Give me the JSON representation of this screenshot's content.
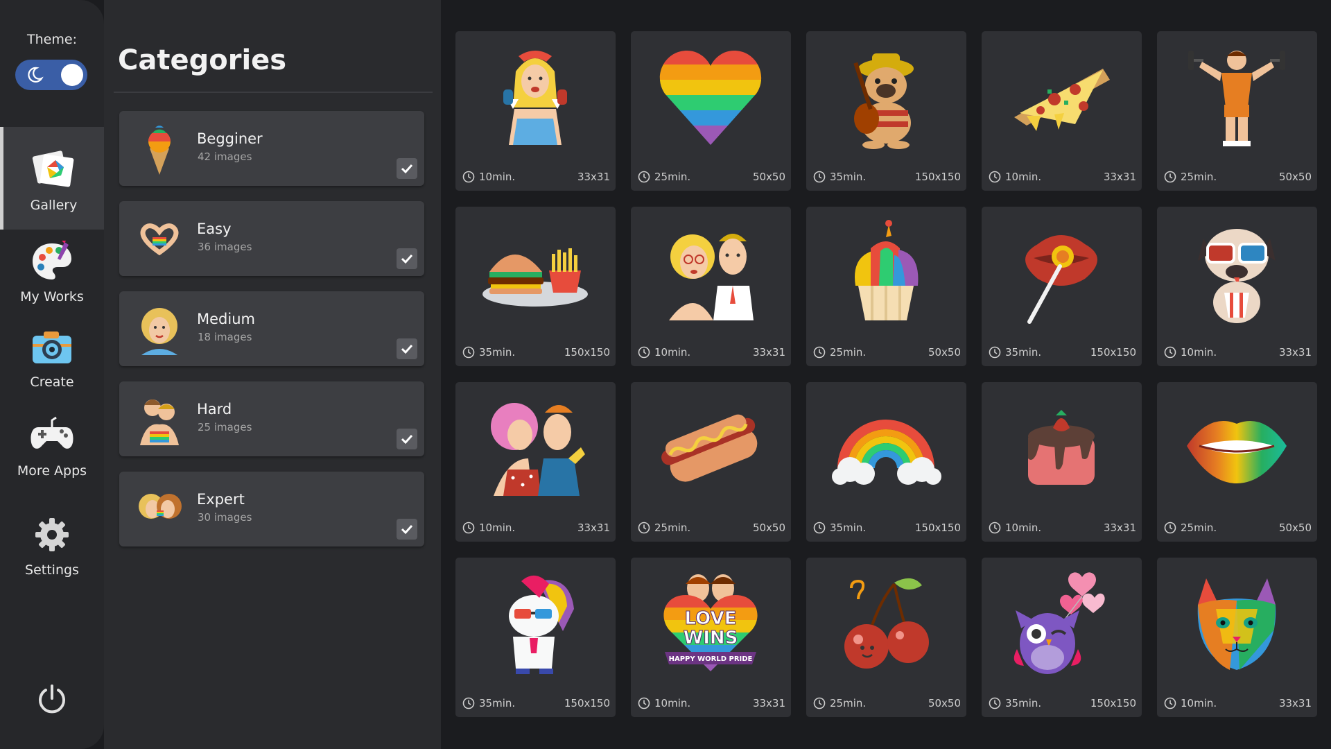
{
  "theme": {
    "label": "Theme:",
    "mode": "dark"
  },
  "nav": [
    {
      "label": "Gallery",
      "icon": "gallery-icon",
      "active": true
    },
    {
      "label": "My Works",
      "icon": "palette-icon",
      "active": false
    },
    {
      "label": "Create",
      "icon": "camera-icon",
      "active": false
    },
    {
      "label": "More Apps",
      "icon": "gamepad-icon",
      "active": false
    },
    {
      "label": "Settings",
      "icon": "gear-icon",
      "active": false
    }
  ],
  "power": {
    "icon": "power-icon"
  },
  "categories": {
    "title": "Categories",
    "items": [
      {
        "name": "Begginer",
        "count": "42 images",
        "checked": true
      },
      {
        "name": "Easy",
        "count": "36 images",
        "checked": true
      },
      {
        "name": "Medium",
        "count": "18 images",
        "checked": true
      },
      {
        "name": "Hard",
        "count": "25 images",
        "checked": true
      },
      {
        "name": "Expert",
        "count": "30 images",
        "checked": true
      }
    ]
  },
  "gallery": [
    {
      "time": "10min.",
      "size": "33x31",
      "subject": "pinup girl with telephone"
    },
    {
      "time": "25min.",
      "size": "50x50",
      "subject": "rainbow heart"
    },
    {
      "time": "35min.",
      "size": "150x150",
      "subject": "pug with guitar"
    },
    {
      "time": "10min.",
      "size": "33x31",
      "subject": "pizza slice"
    },
    {
      "time": "25min.",
      "size": "50x50",
      "subject": "bodybuilder with dumbbells"
    },
    {
      "time": "35min.",
      "size": "150x150",
      "subject": "burger and fries"
    },
    {
      "time": "10min.",
      "size": "33x31",
      "subject": "couple"
    },
    {
      "time": "25min.",
      "size": "50x50",
      "subject": "rainbow cupcake"
    },
    {
      "time": "35min.",
      "size": "150x150",
      "subject": "lips with lollipop"
    },
    {
      "time": "10min.",
      "size": "33x31",
      "subject": "pug with 3D glasses"
    },
    {
      "time": "10min.",
      "size": "33x31",
      "subject": "kissing couple"
    },
    {
      "time": "25min.",
      "size": "50x50",
      "subject": "hot dog"
    },
    {
      "time": "35min.",
      "size": "150x150",
      "subject": "rainbow with clouds"
    },
    {
      "time": "10min.",
      "size": "33x31",
      "subject": "chocolate strawberry cake"
    },
    {
      "time": "25min.",
      "size": "50x50",
      "subject": "rainbow lips"
    },
    {
      "time": "35min.",
      "size": "150x150",
      "subject": "unicorn with sunglasses"
    },
    {
      "time": "10min.",
      "size": "33x31",
      "subject": "love wins badge"
    },
    {
      "time": "25min.",
      "size": "50x50",
      "subject": "cherries"
    },
    {
      "time": "35min.",
      "size": "150x150",
      "subject": "owl with heart balloons"
    },
    {
      "time": "10min.",
      "size": "33x31",
      "subject": "rainbow cat"
    }
  ],
  "artwork_text": {
    "love_wins_top": "LOVE",
    "love_wins_bottom": "WINS",
    "love_wins_ribbon": "HAPPY WORLD PRIDE"
  }
}
